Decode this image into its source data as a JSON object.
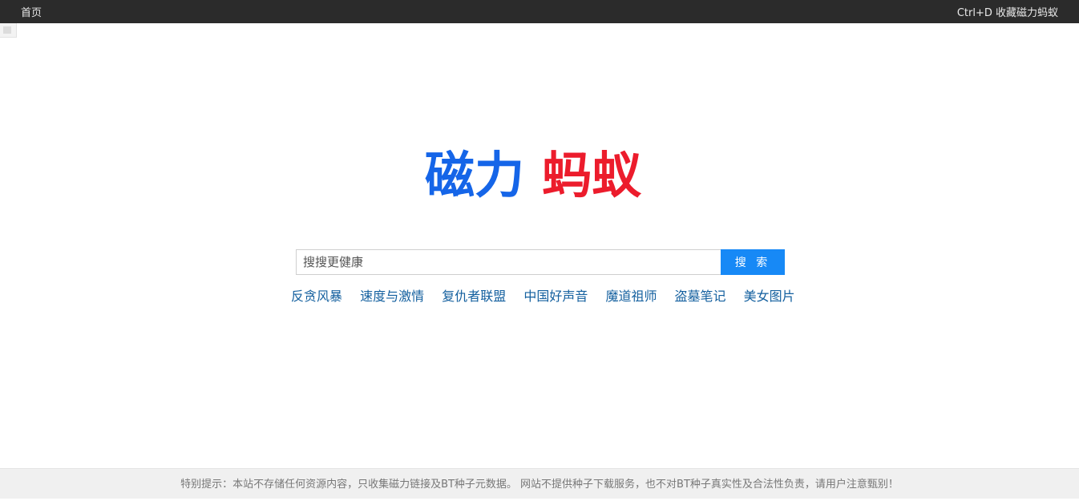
{
  "topbar": {
    "home_label": "首页",
    "bookmark_text": "Ctrl+D 收藏磁力蚂蚁"
  },
  "logo": {
    "part1": "磁力",
    "part2": "蚂蚁",
    "color_blue": "#1565e8",
    "color_red": "#ec1c2c"
  },
  "search": {
    "placeholder": "搜搜更健康",
    "value": "",
    "button_label": "搜 索",
    "button_color": "#1789f6"
  },
  "hot_links": [
    "反贪风暴",
    "速度与激情",
    "复仇者联盟",
    "中国好声音",
    "魔道祖师",
    "盗墓笔记",
    "美女图片"
  ],
  "footer": {
    "notice": "特别提示：本站不存储任何资源内容，只收集磁力链接及BT种子元数据。 网站不提供种子下载服务，也不对BT种子真实性及合法性负责，请用户注意甄别！"
  }
}
